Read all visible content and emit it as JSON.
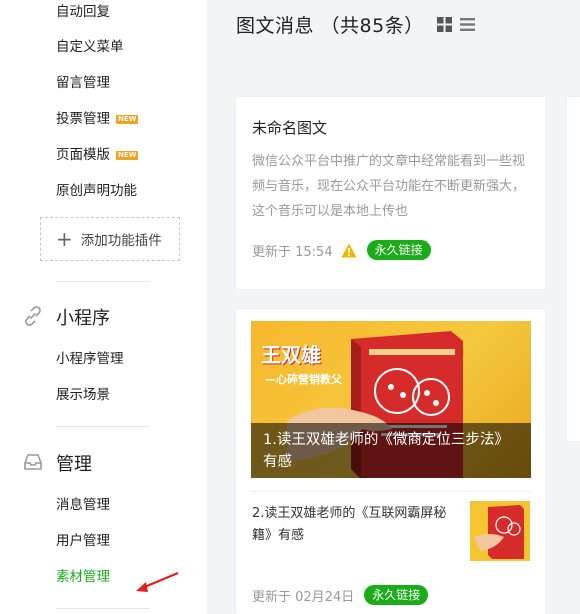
{
  "sidebar": {
    "items_top": [
      {
        "label": "自动回复"
      },
      {
        "label": "自定义菜单"
      },
      {
        "label": "留言管理"
      },
      {
        "label": "投票管理",
        "badge": "NEW"
      },
      {
        "label": "页面模版",
        "badge": "NEW"
      },
      {
        "label": "原创声明功能"
      }
    ],
    "add_plugin": {
      "icon": "plus-icon",
      "label": "添加功能插件"
    },
    "miniprogram": {
      "icon": "link-icon",
      "title": "小程序",
      "items": [
        {
          "label": "小程序管理"
        },
        {
          "label": "展示场景"
        }
      ]
    },
    "manage": {
      "icon": "inbox-icon",
      "title": "管理",
      "items": [
        {
          "label": "消息管理"
        },
        {
          "label": "用户管理"
        },
        {
          "label": "素材管理",
          "active": true
        }
      ]
    },
    "accent_color": "#1aad19"
  },
  "main": {
    "title": "图文消息 （共85条）",
    "view_icons": [
      "grid-icon",
      "list-icon"
    ],
    "cards": [
      {
        "title": "未命名图文",
        "description": "微信公众平台中推广的文章中经常能看到一些视频与音乐，现在公众平台功能在不断更新强大，这个音乐可以是本地上传也",
        "updated": "更新于 15:54",
        "warning_icon": "warning-icon",
        "badge": "永久链接"
      },
      {
        "cover_caption": "1.读王双雄老师的《微商定位三步法》有感",
        "cover_text": "王双雄",
        "cover_subtext": "—心碎营销教父",
        "sub_item": "2.读王双雄老师的《互联网霸屏秘籍》有感",
        "updated": "更新于 02月24日",
        "badge": "永久链接"
      }
    ]
  }
}
